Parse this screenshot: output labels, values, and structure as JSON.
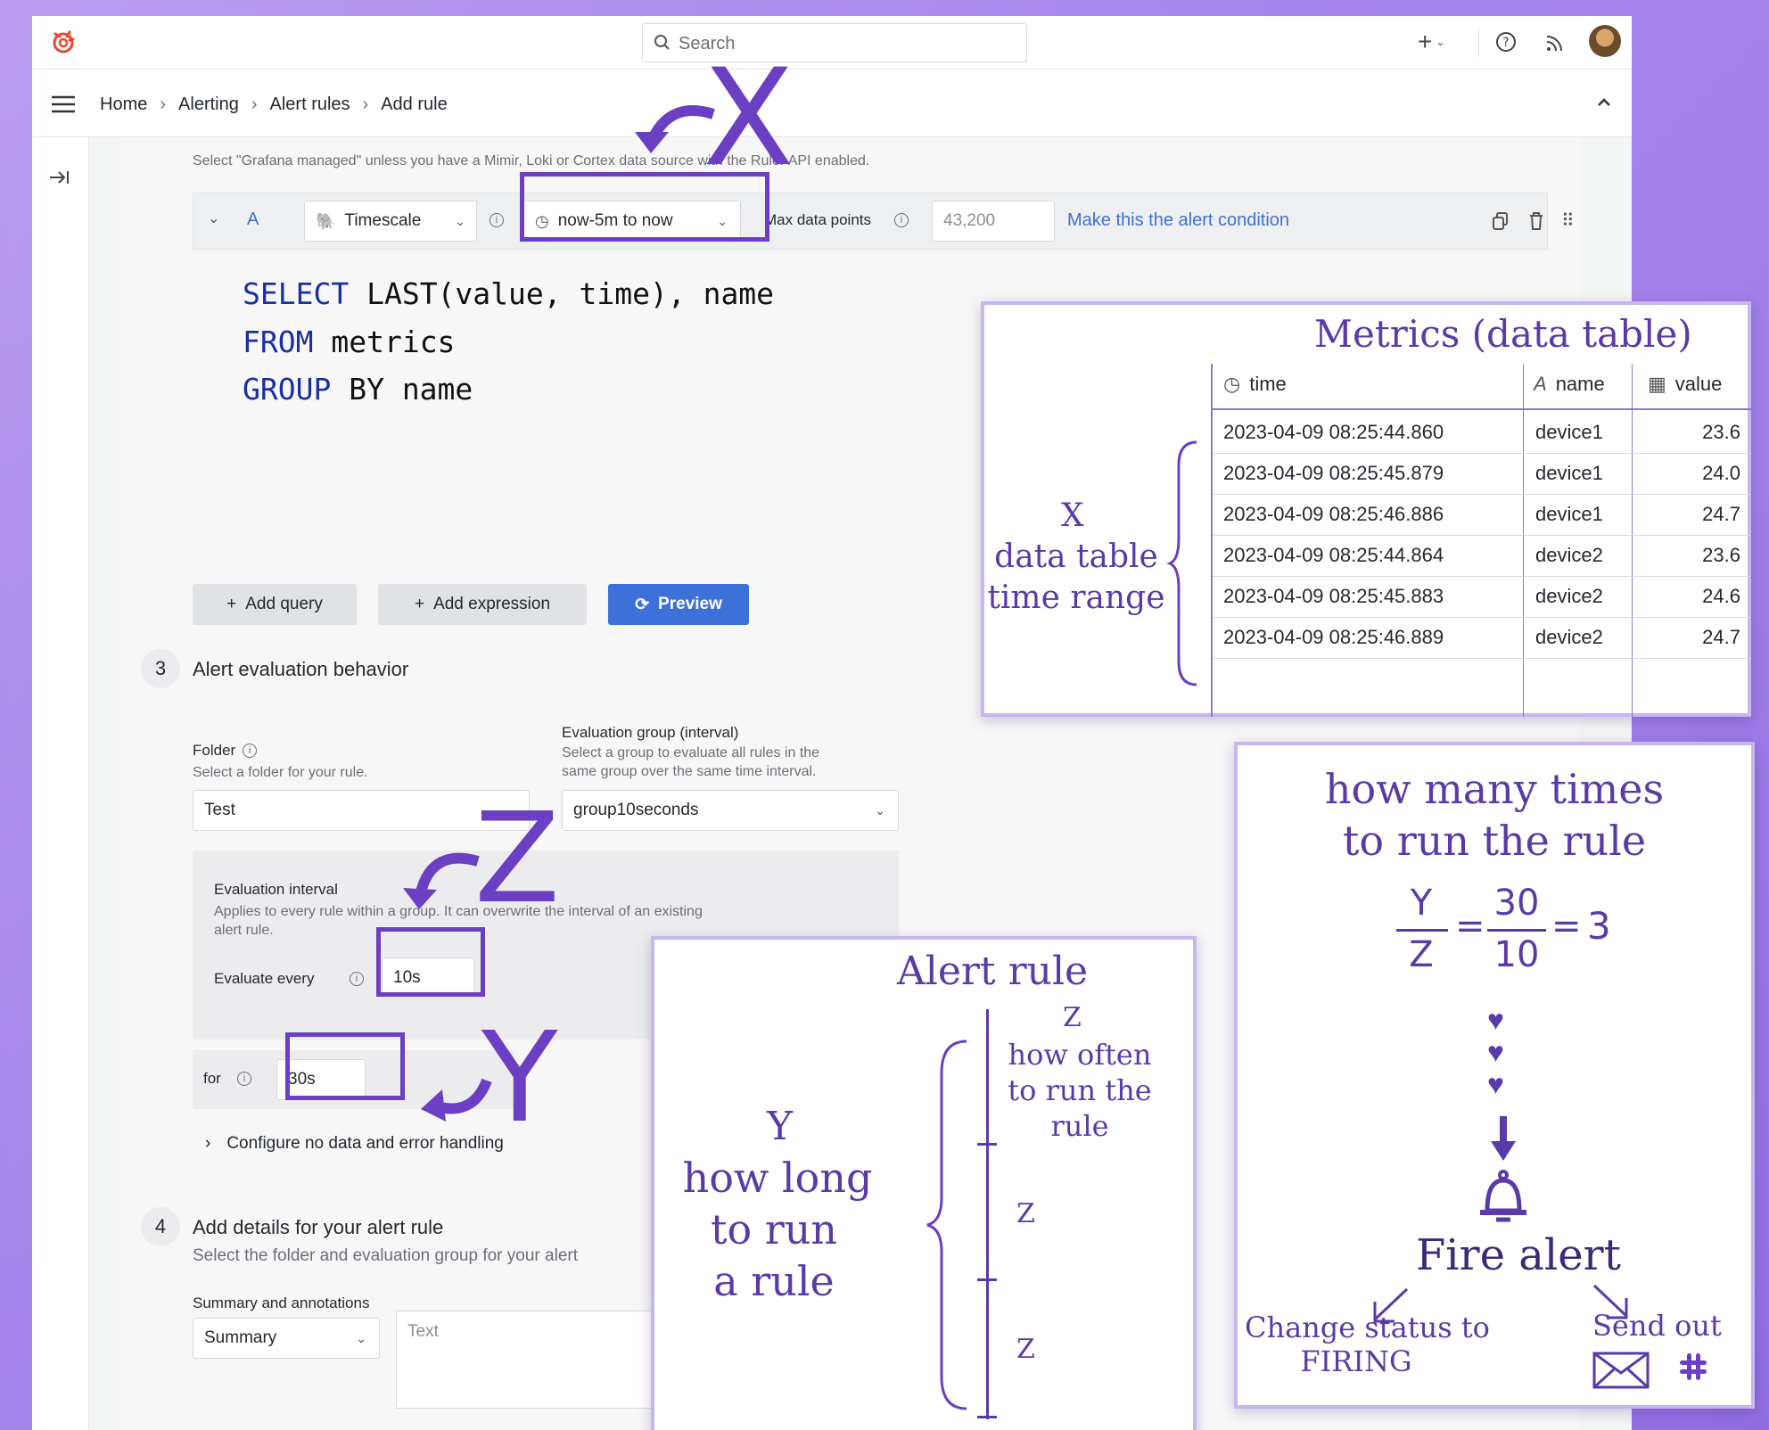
{
  "topbar": {
    "search_placeholder": "Search",
    "add_label": "+"
  },
  "breadcrumb": {
    "items": [
      "Home",
      "Alerting",
      "Alert rules",
      "Add rule"
    ],
    "separator": "›"
  },
  "query_section": {
    "help_text": "Select \"Grafana managed\" unless you have a Mimir, Loki or Cortex data source with the Ruler API enabled.",
    "query_letter": "A",
    "datasource": "Timescale",
    "time_range": "now-5m to now",
    "max_data_points_label": "Max data points",
    "max_data_points_value": "43,200",
    "alert_condition_link": "Make this the alert condition",
    "sql_lines": [
      {
        "kw": "SELECT",
        "rest": " LAST(value, time), name"
      },
      {
        "kw": "FROM",
        "rest": " metrics"
      },
      {
        "kw": "GROUP",
        "rest": " BY name"
      }
    ],
    "add_query_label": "Add query",
    "add_expression_label": "Add expression",
    "preview_label": "Preview"
  },
  "evaluation_section": {
    "step_number": "3",
    "title": "Alert evaluation behavior",
    "folder_label": "Folder",
    "folder_help": "Select a folder for your rule.",
    "folder_value": "Test",
    "group_label": "Evaluation group (interval)",
    "group_help_1": "Select a group to evaluate all rules in the",
    "group_help_2": "same group over the same time interval.",
    "group_value": "group10seconds",
    "interval_label": "Evaluation interval",
    "interval_help_1": "Applies to every rule within a group. It can overwrite the interval of an existing",
    "interval_help_2": "alert rule.",
    "evaluate_every_label": "Evaluate every",
    "evaluate_every_value": "10s",
    "for_label": "for",
    "for_value": "30s",
    "no_data_label": "Configure no data and error handling"
  },
  "details_section": {
    "step_number": "4",
    "title": "Add details for your alert rule",
    "help": "Select the folder and evaluation group for your alert",
    "summary_label": "Summary and annotations",
    "summary_select": "Summary",
    "text_placeholder": "Text"
  },
  "annotations": {
    "x": "X",
    "y": "Y",
    "z": "Z"
  },
  "metrics_card": {
    "title": "Metrics (data table)",
    "columns": [
      "time",
      "name",
      "value"
    ],
    "rows": [
      [
        "2023-04-09 08:25:44.860",
        "device1",
        "23.6"
      ],
      [
        "2023-04-09 08:25:45.879",
        "device1",
        "24.0"
      ],
      [
        "2023-04-09 08:25:46.886",
        "device1",
        "24.7"
      ],
      [
        "2023-04-09 08:25:44.864",
        "device2",
        "23.6"
      ],
      [
        "2023-04-09 08:25:45.883",
        "device2",
        "24.6"
      ],
      [
        "2023-04-09 08:25:46.889",
        "device2",
        "24.7"
      ]
    ],
    "brace_letter": "X",
    "brace_line1": "data table",
    "brace_line2": "time range"
  },
  "alert_rule_card": {
    "title": "Alert rule",
    "left_letter": "Y",
    "left_line1": "how long",
    "left_line2": "to run",
    "left_line3": "a rule",
    "top_z": "Z",
    "top_line1": "how often",
    "top_line2": "to run the",
    "top_line3": "rule",
    "mid_z": "Z",
    "bottom_z": "Z"
  },
  "fire_card": {
    "title_line1": "how many times",
    "title_line2": "to run the rule",
    "frac1_num": "Y",
    "frac1_den": "Z",
    "frac2_num": "30",
    "frac2_den": "10",
    "equals": "=",
    "result": "3",
    "fire_label": "Fire alert",
    "left_line1": "Change status to",
    "left_line2": "FIRING",
    "right_label": "Send out"
  },
  "colors": {
    "annotation_purple": "#6a3fc4",
    "card_text": "#5a3aa8",
    "preview_blue": "#3d71d9",
    "link_blue": "#3d71d9"
  }
}
